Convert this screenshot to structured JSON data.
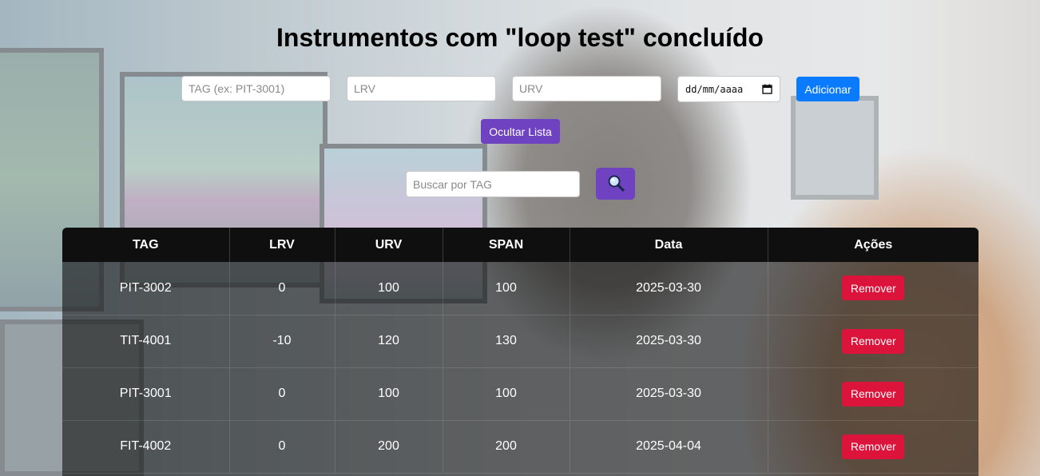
{
  "page": {
    "title": "Instrumentos com \"loop test\" concluído"
  },
  "form": {
    "tag_placeholder": "TAG (ex: PIT-3001)",
    "lrv_placeholder": "LRV",
    "urv_placeholder": "URV",
    "date_placeholder": "dd/mm/aaaa",
    "add_label": "Adicionar"
  },
  "toggle": {
    "label": "Ocultar Lista"
  },
  "search": {
    "placeholder": "Buscar por TAG",
    "icon": "search-icon"
  },
  "table": {
    "headers": [
      "TAG",
      "LRV",
      "URV",
      "SPAN",
      "Data",
      "Ações"
    ],
    "rows": [
      {
        "tag": "PIT-3002",
        "lrv": "0",
        "urv": "100",
        "span": "100",
        "data": "2025-03-30",
        "action": "Remover"
      },
      {
        "tag": "TIT-4001",
        "lrv": "-10",
        "urv": "120",
        "span": "130",
        "data": "2025-03-30",
        "action": "Remover"
      },
      {
        "tag": "PIT-3001",
        "lrv": "0",
        "urv": "100",
        "span": "100",
        "data": "2025-03-30",
        "action": "Remover"
      },
      {
        "tag": "FIT-4002",
        "lrv": "0",
        "urv": "200",
        "span": "200",
        "data": "2025-04-04",
        "action": "Remover"
      }
    ]
  },
  "colors": {
    "add_button": "#0a7bff",
    "purple_button": "#6f42c1",
    "remove_button": "#dc143c",
    "table_header": "#0f0f0f"
  }
}
